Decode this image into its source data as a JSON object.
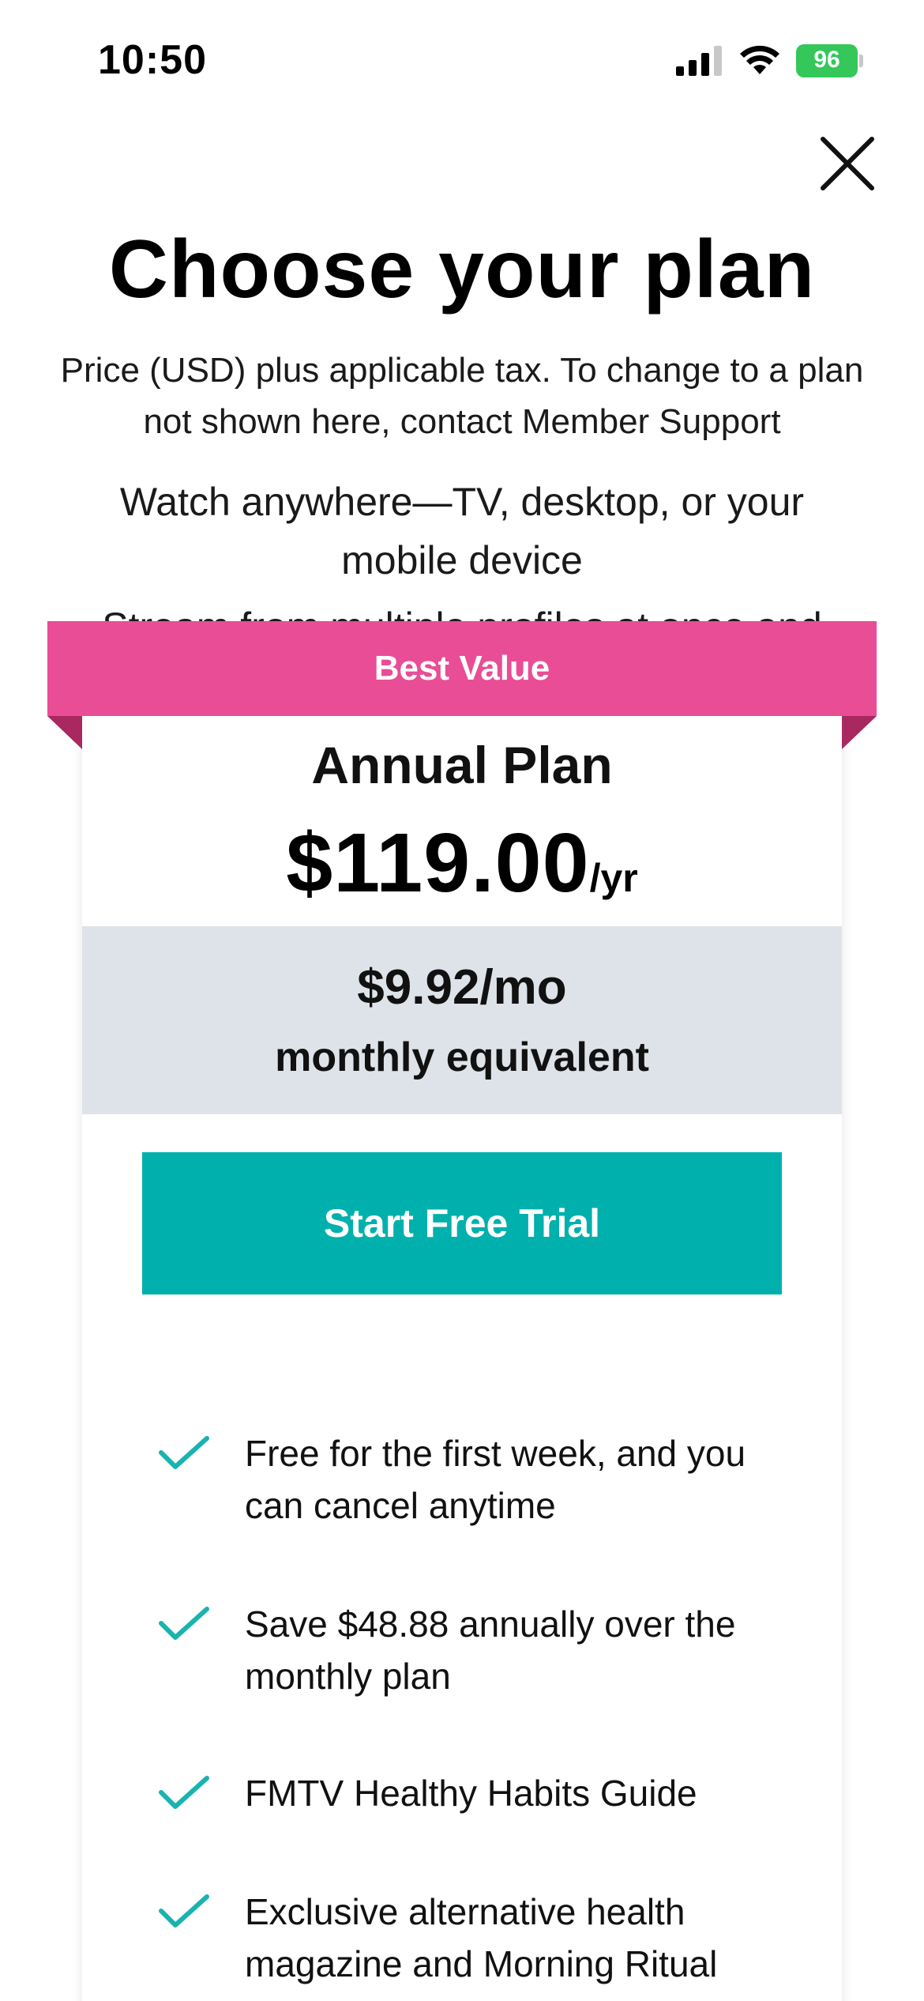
{
  "status_bar": {
    "time": "10:50",
    "battery_level": "96",
    "battery_color": "#34c759"
  },
  "header": {
    "close_icon": "close-icon",
    "title": "Choose your plan",
    "subtitle": "Price (USD) plus applicable tax. To change to a plan not shown here, contact Member Support",
    "feature_line": "Watch anywhere—TV, desktop, or your mobile device",
    "feature_line_partial": "Stream from multiple profiles at once and"
  },
  "plan": {
    "badge": "Best Value",
    "name": "Annual Plan",
    "price": "$119.00",
    "price_unit": "/yr",
    "monthly_price": "$9.92/mo",
    "monthly_label": "monthly equivalent",
    "cta_label": "Start Free Trial",
    "colors": {
      "badge": "#e84d96",
      "cta": "#00b0ad",
      "check": "#19b3b0",
      "equiv_bg": "#dde3e9"
    },
    "benefits": [
      {
        "icon": "check-icon",
        "text": "Free for the first week, and you can cancel anytime"
      },
      {
        "icon": "check-icon",
        "text": "Save $48.88 annually over the monthly plan"
      },
      {
        "icon": "check-icon",
        "text": "FMTV Healthy Habits Guide"
      },
      {
        "icon": "check-icon",
        "text": "Exclusive alternative health magazine and Morning Ritual calendar"
      }
    ]
  }
}
